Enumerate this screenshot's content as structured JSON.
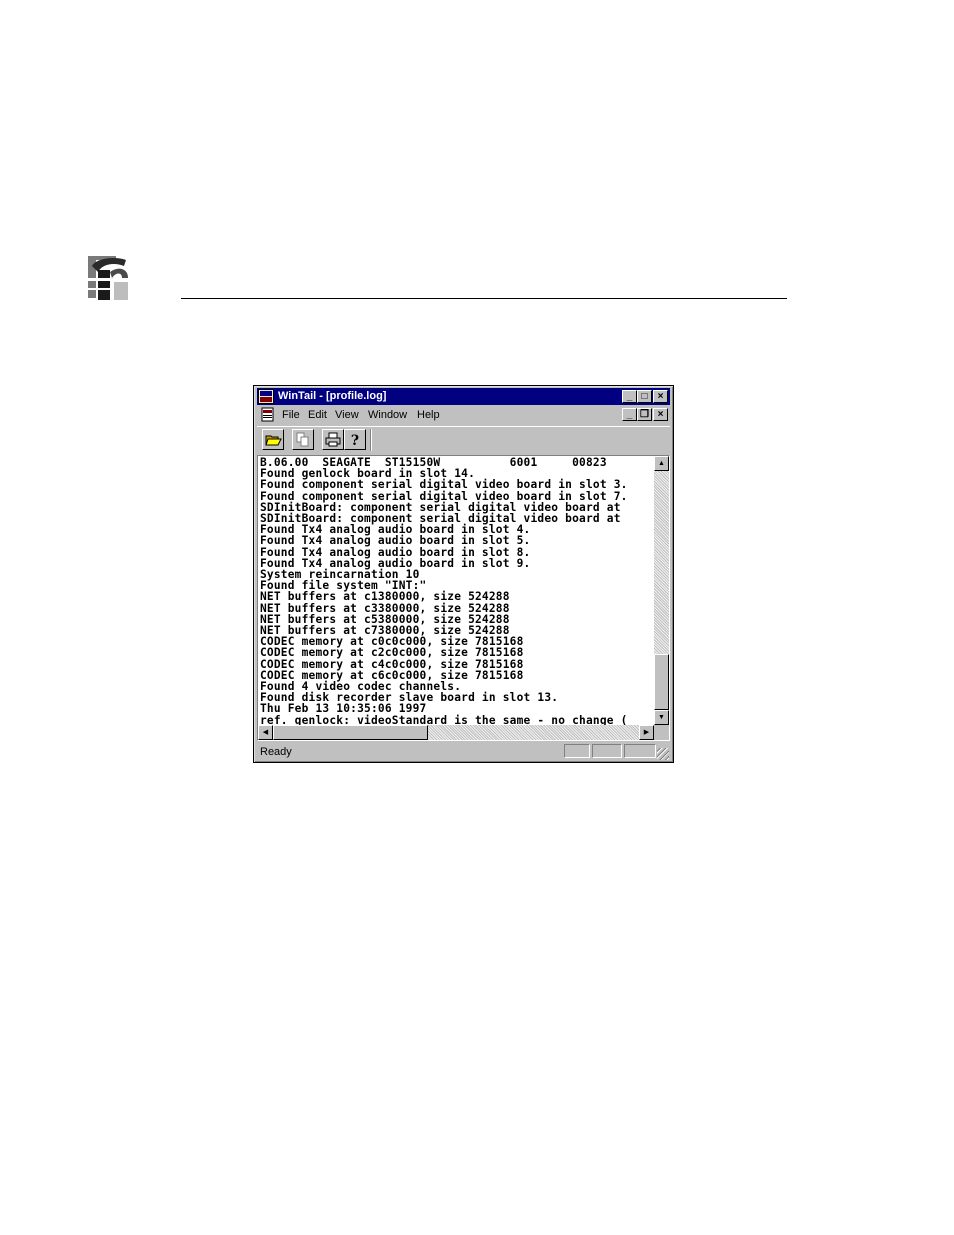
{
  "window": {
    "title": "WinTail - [profile.log]",
    "app_icon": "wintail-app-icon",
    "caption_buttons": {
      "minimize": "_",
      "maximize": "□",
      "close": "×"
    },
    "mdi_buttons": {
      "minimize": "_",
      "restore": "❐",
      "close": "×"
    }
  },
  "menu": [
    "File",
    "Edit",
    "View",
    "Window",
    "Help"
  ],
  "toolbar": {
    "buttons": [
      "open-folder-icon",
      "copy-icon",
      "print-icon",
      "help-icon"
    ]
  },
  "log": {
    "lines": [
      "B.06.00  SEAGATE  ST15150W          6001     00823",
      "Found genlock board in slot 14.",
      "Found component serial digital video board in slot 3.",
      "Found component serial digital video board in slot 7.",
      "SDInitBoard: component serial digital video board at",
      "SDInitBoard: component serial digital video board at",
      "Found Tx4 analog audio board in slot 4.",
      "Found Tx4 analog audio board in slot 5.",
      "Found Tx4 analog audio board in slot 8.",
      "Found Tx4 analog audio board in slot 9.",
      "System reincarnation 10",
      "Found file system \"INT:\"",
      "NET buffers at c1380000, size 524288",
      "NET buffers at c3380000, size 524288",
      "NET buffers at c5380000, size 524288",
      "NET buffers at c7380000, size 524288",
      "CODEC memory at c0c0c000, size 7815168",
      "CODEC memory at c2c0c000, size 7815168",
      "CODEC memory at c4c0c000, size 7815168",
      "CODEC memory at c6c0c000, size 7815168",
      "Found 4 video codec channels.",
      "Found disk recorder slave board in slot 13.",
      "Thu Feb 13 10:35:06 1997",
      "ref. genlock: videoStandard is the same - no change ("
    ]
  },
  "status": {
    "text": "Ready"
  }
}
